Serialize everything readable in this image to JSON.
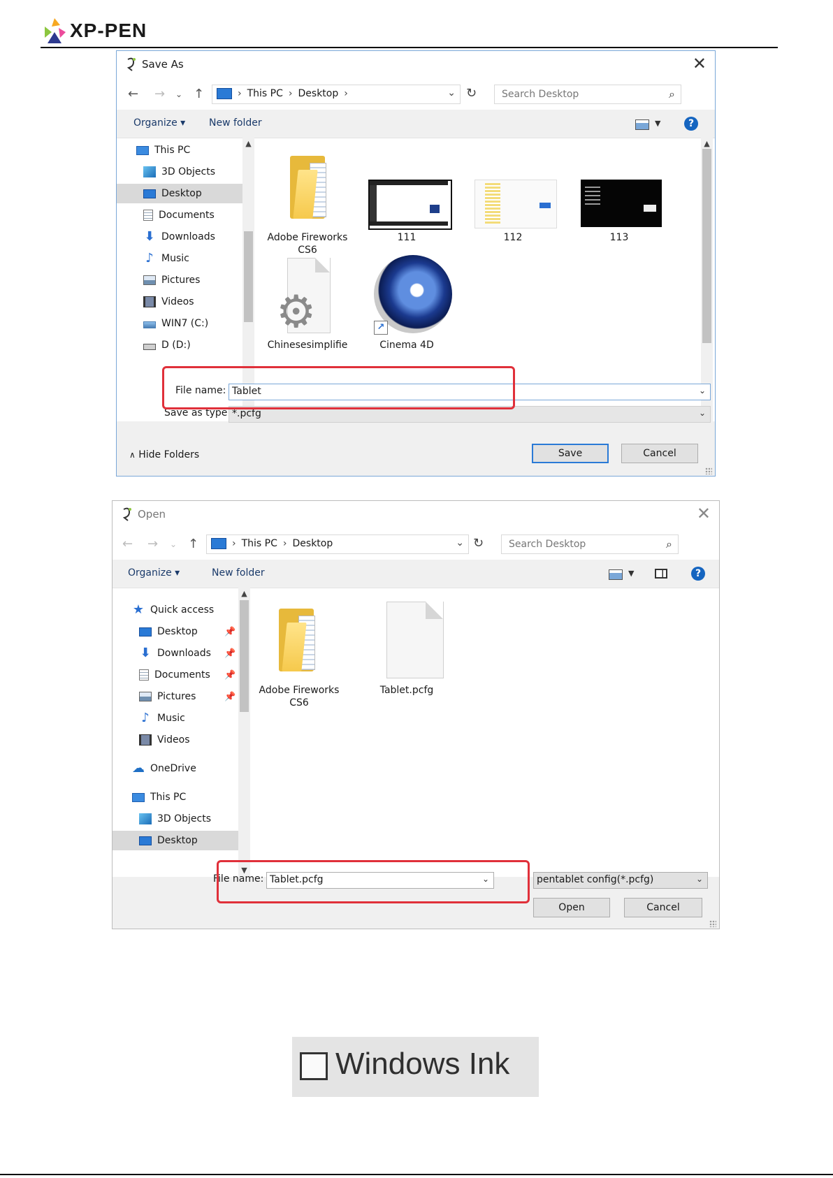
{
  "header": {
    "brand": "XP-PEN"
  },
  "save_dialog": {
    "title": "Save As",
    "breadcrumb": [
      "This PC",
      "Desktop"
    ],
    "search_placeholder": "Search Desktop",
    "toolbar": {
      "organize": "Organize ▾",
      "new_folder": "New folder"
    },
    "nav_items": [
      {
        "label": "This PC",
        "icon": "computer-icon"
      },
      {
        "label": "3D Objects",
        "icon": "3d-objects-icon"
      },
      {
        "label": "Desktop",
        "icon": "desktop-icon"
      },
      {
        "label": "Documents",
        "icon": "documents-icon"
      },
      {
        "label": "Downloads",
        "icon": "downloads-icon"
      },
      {
        "label": "Music",
        "icon": "music-icon"
      },
      {
        "label": "Pictures",
        "icon": "pictures-icon"
      },
      {
        "label": "Videos",
        "icon": "videos-icon"
      },
      {
        "label": "WIN7 (C:)",
        "icon": "drive-c-icon"
      },
      {
        "label": "D (D:)",
        "icon": "drive-icon"
      }
    ],
    "files": [
      {
        "label": "Adobe Fireworks CS6",
        "icon": "folder-icon"
      },
      {
        "label": "111",
        "icon": "screenshot-thumbnail"
      },
      {
        "label": "112",
        "icon": "screenshot-thumbnail"
      },
      {
        "label": "113",
        "icon": "screenshot-thumbnail"
      },
      {
        "label": "Chinesesimplifie",
        "icon": "settings-file-icon"
      },
      {
        "label": "Cinema 4D",
        "icon": "cinema4d-shortcut-icon"
      }
    ],
    "file_name_label": "File name:",
    "file_name_value": "Tablet",
    "save_type_label": "Save as type:",
    "save_type_value": "*.pcfg",
    "hide_folders": "Hide Folders",
    "save_button": "Save",
    "cancel_button": "Cancel"
  },
  "open_dialog": {
    "title": "Open",
    "breadcrumb": [
      "This PC",
      "Desktop"
    ],
    "search_placeholder": "Search Desktop",
    "toolbar": {
      "organize": "Organize ▾",
      "new_folder": "New folder"
    },
    "nav_items": [
      {
        "label": "Quick access",
        "icon": "star-icon"
      },
      {
        "label": "Desktop",
        "icon": "desktop-icon",
        "pinned": true
      },
      {
        "label": "Downloads",
        "icon": "downloads-icon",
        "pinned": true
      },
      {
        "label": "Documents",
        "icon": "documents-icon",
        "pinned": true
      },
      {
        "label": "Pictures",
        "icon": "pictures-icon",
        "pinned": true
      },
      {
        "label": "Music",
        "icon": "music-icon"
      },
      {
        "label": "Videos",
        "icon": "videos-icon"
      },
      {
        "label": "OneDrive",
        "icon": "onedrive-icon"
      },
      {
        "label": "This PC",
        "icon": "computer-icon"
      },
      {
        "label": "3D Objects",
        "icon": "3d-objects-icon"
      },
      {
        "label": "Desktop",
        "icon": "desktop-icon"
      }
    ],
    "files": [
      {
        "label": "Adobe Fireworks CS6",
        "icon": "folder-icon"
      },
      {
        "label": "Tablet.pcfg",
        "icon": "blank-file-icon"
      }
    ],
    "file_name_label": "File name:",
    "file_name_value": "Tablet.pcfg",
    "file_type_value": "pentablet config(*.pcfg)",
    "open_button": "Open",
    "cancel_button": "Cancel"
  },
  "windows_ink": {
    "label": "Windows Ink",
    "checked": false
  },
  "colors": {
    "accent": "#2a7ad6",
    "highlight": "#e0303a"
  }
}
